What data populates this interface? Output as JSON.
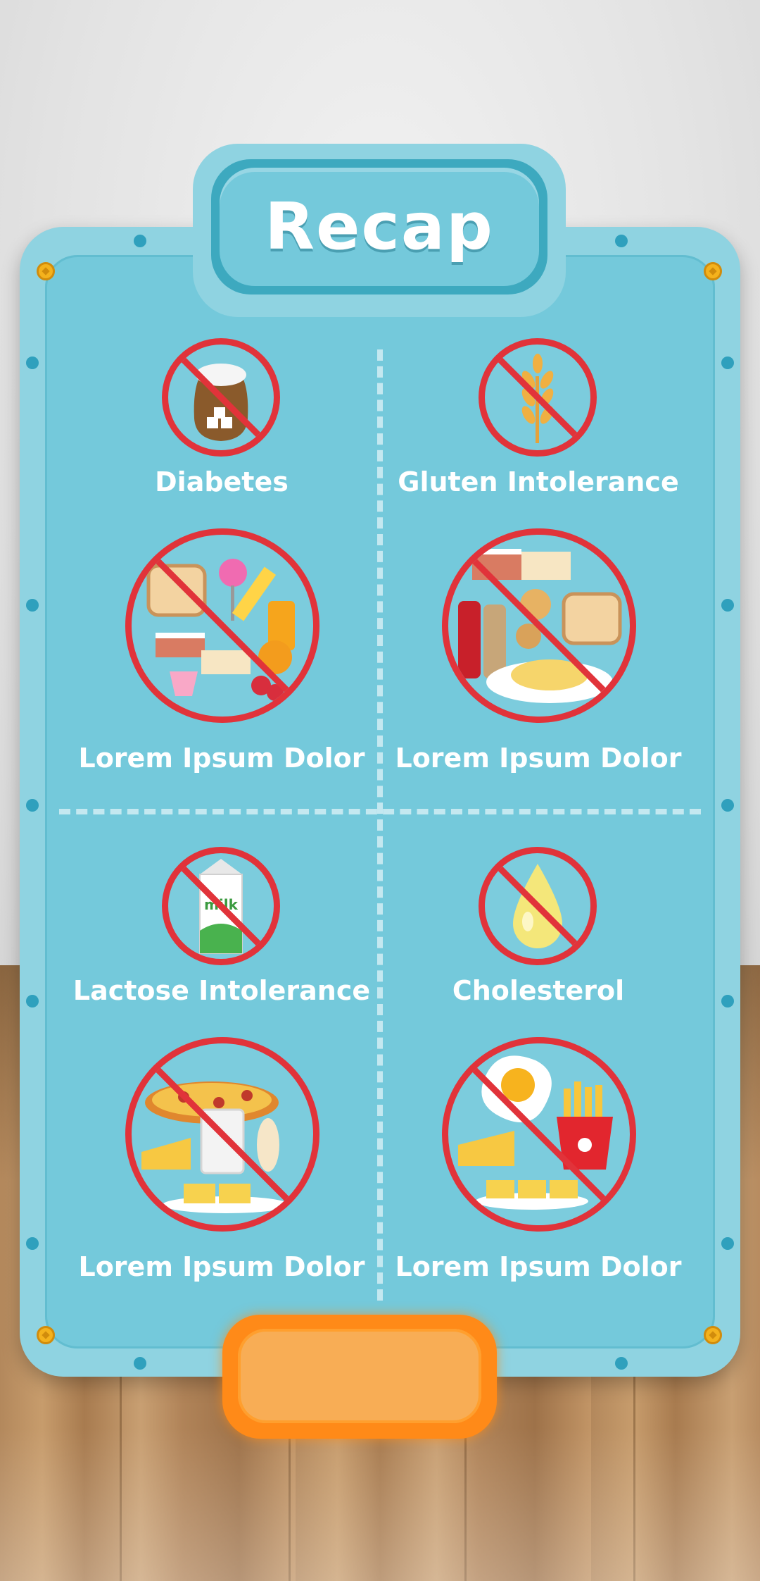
{
  "title": "Recap",
  "colors": {
    "board": "#8fd3e1",
    "panel": "#74c9db",
    "prohibit": "#e1333a",
    "button": "#ff8a18",
    "text": "#ffffff"
  },
  "quadrants": [
    {
      "condition": "Diabetes",
      "condition_icon": "sugar-sack-icon",
      "foods_icon": "sweets-icon",
      "foods_label": "Lorem Ipsum Dolor"
    },
    {
      "condition": "Gluten Intolerance",
      "condition_icon": "wheat-icon",
      "foods_icon": "gluten-foods-icon",
      "foods_label": "Lorem Ipsum Dolor"
    },
    {
      "condition": "Lactose Intolerance",
      "condition_icon": "milk-carton-icon",
      "foods_icon": "dairy-foods-icon",
      "foods_label": "Lorem Ipsum Dolor"
    },
    {
      "condition": "Cholesterol",
      "condition_icon": "oil-drop-icon",
      "foods_icon": "fatty-foods-icon",
      "foods_label": "Lorem Ipsum Dolor"
    }
  ],
  "milk_text": "milk",
  "continue_button_label": ""
}
